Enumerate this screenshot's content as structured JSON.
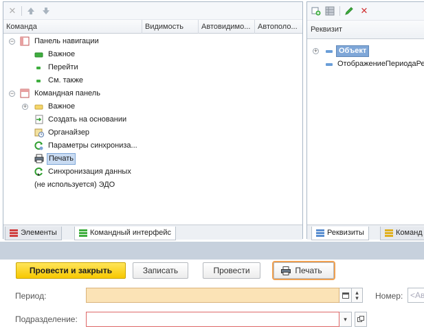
{
  "left_panel": {
    "columns": [
      "Команда",
      "Видимость",
      "Автовидимо...",
      "Автополо..."
    ],
    "tree": [
      {
        "label": "Панель навигации",
        "level": 0,
        "expander": "−",
        "icon": "nav-panel-icon"
      },
      {
        "label": "Важное",
        "level": 1,
        "icon": "green-bar-icon"
      },
      {
        "label": "Перейти",
        "level": 1,
        "icon": "green-dot-icon"
      },
      {
        "label": "См. также",
        "level": 1,
        "icon": "green-dot-icon"
      },
      {
        "label": "Командная панель",
        "level": 0,
        "expander": "−",
        "icon": "command-panel-icon"
      },
      {
        "label": "Важное",
        "level": 1,
        "expander": "+",
        "icon": "yellow-bar-icon"
      },
      {
        "label": "Создать на основании",
        "level": 1,
        "icon": "create-based-icon"
      },
      {
        "label": "Органайзер",
        "level": 1,
        "icon": "organizer-icon"
      },
      {
        "label": "Параметры синхрониза...",
        "level": 1,
        "icon": "sync-params-icon"
      },
      {
        "label": "Печать",
        "level": 1,
        "icon": "printer-icon",
        "selected": true
      },
      {
        "label": "Синхронизация данных",
        "level": 1,
        "icon": "sync-icon"
      },
      {
        "label": "(не используется) ЭДО",
        "level": 1,
        "icon": ""
      }
    ],
    "tabs": [
      {
        "label": "Элементы",
        "active": false
      },
      {
        "label": "Командный интерфейс",
        "active": true
      }
    ]
  },
  "right_panel": {
    "header": "Реквизит",
    "items": [
      {
        "label": "Объект",
        "expander": "+",
        "selected": true
      },
      {
        "label": "ОтображениеПериодаРе"
      }
    ],
    "tabs": [
      {
        "label": "Реквизиты",
        "active": true
      },
      {
        "label": "Команд",
        "active": false
      }
    ]
  },
  "form": {
    "buttons": {
      "post_and_close": "Провести и закрыть",
      "save": "Записать",
      "post": "Провести",
      "print": "Печать"
    },
    "fields": {
      "period_label": "Период:",
      "number_label": "Номер:",
      "number_placeholder": "<Ав",
      "subdivision_label": "Подразделение:"
    }
  },
  "colors": {
    "primary_button": "#f7c800",
    "required_field": "#fbe3b6",
    "selection": "#c9dbf2",
    "focus_outline": "#f0a050"
  }
}
